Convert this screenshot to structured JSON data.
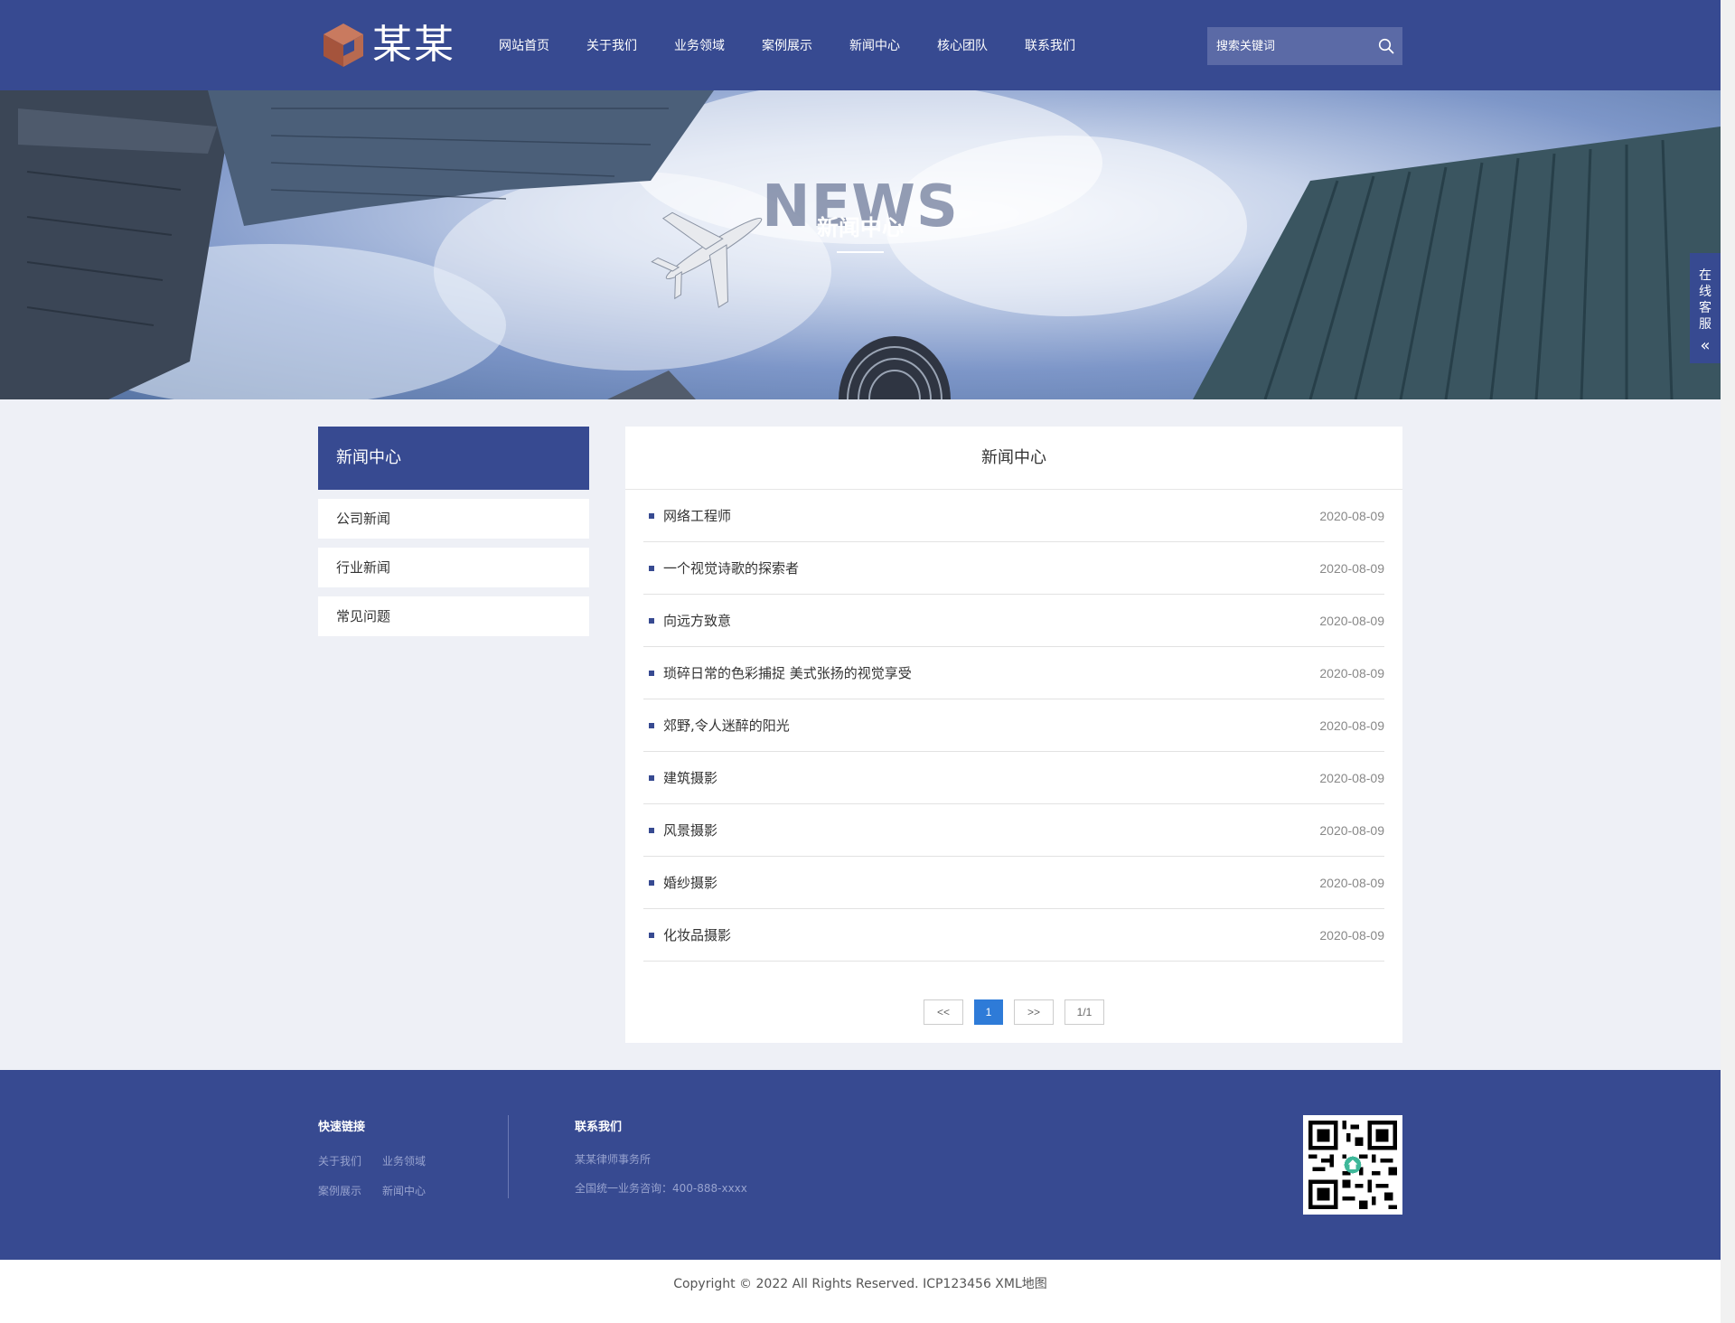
{
  "brand": {
    "logo_text": "某某"
  },
  "nav": {
    "items": [
      {
        "label": "网站首页"
      },
      {
        "label": "关于我们"
      },
      {
        "label": "业务领域"
      },
      {
        "label": "案例展示"
      },
      {
        "label": "新闻中心"
      },
      {
        "label": "核心团队"
      },
      {
        "label": "联系我们"
      }
    ]
  },
  "search": {
    "placeholder": "搜索关键词"
  },
  "banner": {
    "title_en": "NEWS",
    "title_cn": "新闻中心"
  },
  "online_service": {
    "label": "在线客服"
  },
  "sidebar": {
    "title": "新闻中心",
    "items": [
      {
        "label": "公司新闻"
      },
      {
        "label": "行业新闻"
      },
      {
        "label": "常见问题"
      }
    ]
  },
  "main": {
    "title": "新闻中心",
    "news": [
      {
        "title": "网络工程师",
        "date": "2020-08-09"
      },
      {
        "title": "一个视觉诗歌的探索者",
        "date": "2020-08-09"
      },
      {
        "title": "向远方致意",
        "date": "2020-08-09"
      },
      {
        "title": "琐碎日常的色彩捕捉 美式张扬的视觉享受",
        "date": "2020-08-09"
      },
      {
        "title": "郊野,令人迷醉的阳光",
        "date": "2020-08-09"
      },
      {
        "title": "建筑摄影",
        "date": "2020-08-09"
      },
      {
        "title": "风景摄影",
        "date": "2020-08-09"
      },
      {
        "title": "婚纱摄影",
        "date": "2020-08-09"
      },
      {
        "title": "化妆品摄影",
        "date": "2020-08-09"
      }
    ],
    "pagination": {
      "prev": "<<",
      "current": "1",
      "next": ">>",
      "info": "1/1"
    }
  },
  "footer": {
    "links_title": "快速链接",
    "links": [
      {
        "label": "关于我们"
      },
      {
        "label": "业务领域"
      },
      {
        "label": "案例展示"
      },
      {
        "label": "新闻中心"
      }
    ],
    "contact_title": "联系我们",
    "contact_lines": [
      "某某律师事务所",
      "全国统一业务咨询：400-888-xxxx"
    ]
  },
  "copyright": "Copyright © 2022 All Rights Reserved. ICP123456 XML地图",
  "colors": {
    "primary": "#374a91",
    "accent": "#2e7bd8",
    "logo_mark": "#b35e45"
  }
}
